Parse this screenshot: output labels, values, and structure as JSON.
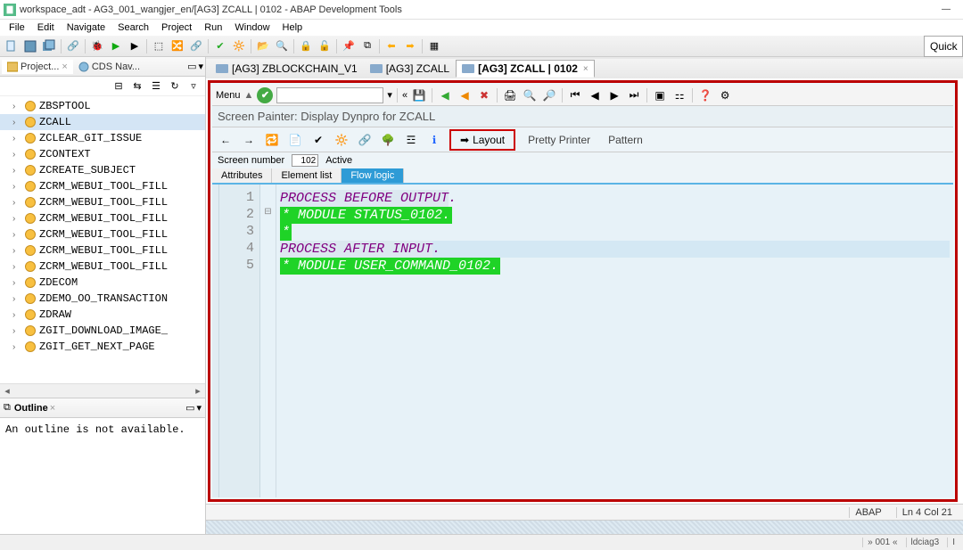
{
  "titlebar": {
    "title": "workspace_adt - AG3_001_wangjer_en/[AG3] ZCALL | 0102 - ABAP Development Tools"
  },
  "menubar": [
    "File",
    "Edit",
    "Navigate",
    "Search",
    "Project",
    "Run",
    "Window",
    "Help"
  ],
  "quick_access": "Quick",
  "left": {
    "tab_project": "Project...",
    "tab_cds": "CDS Nav...",
    "tree": [
      "ZBSPTOOL",
      "ZCALL",
      "ZCLEAR_GIT_ISSUE",
      "ZCONTEXT",
      "ZCREATE_SUBJECT",
      "ZCRM_WEBUI_TOOL_FILL",
      "ZCRM_WEBUI_TOOL_FILL",
      "ZCRM_WEBUI_TOOL_FILL",
      "ZCRM_WEBUI_TOOL_FILL",
      "ZCRM_WEBUI_TOOL_FILL",
      "ZCRM_WEBUI_TOOL_FILL",
      "ZDECOM",
      "ZDEMO_OO_TRANSACTION",
      "ZDRAW",
      "ZGIT_DOWNLOAD_IMAGE_",
      "ZGIT_GET_NEXT_PAGE"
    ],
    "selected_index": 1
  },
  "outline": {
    "title": "Outline",
    "message": "An outline is not available."
  },
  "editor_tabs": [
    {
      "label": "[AG3] ZBLOCKCHAIN_V1",
      "active": false
    },
    {
      "label": "[AG3] ZCALL",
      "active": false
    },
    {
      "label": "[AG3] ZCALL | 0102",
      "active": true
    }
  ],
  "sap": {
    "menu_label": "Menu",
    "painter_title": "Screen Painter: Display Dynpro for ZCALL",
    "layout_btn": "Layout",
    "pretty_printer": "Pretty Printer",
    "pattern": "Pattern",
    "screen_number_label": "Screen number",
    "screen_number_value": "102",
    "status_active": "Active",
    "sub_tabs": [
      "Attributes",
      "Element list",
      "Flow logic"
    ],
    "active_sub_tab": 2
  },
  "code": {
    "lines": [
      {
        "type": "kw",
        "text": "PROCESS BEFORE OUTPUT"
      },
      {
        "type": "comment",
        "text": "* MODULE STATUS_0102."
      },
      {
        "type": "comment",
        "text": "*"
      },
      {
        "type": "kw",
        "text": "PROCESS AFTER INPUT",
        "highlight": true
      },
      {
        "type": "comment",
        "text": "* MODULE USER_COMMAND_0102."
      }
    ]
  },
  "editor_status": {
    "lang": "ABAP",
    "pos": "Ln   4 Col  21"
  },
  "app_status": {
    "a": "» 001 «",
    "b": "ldciag3",
    "c": "I"
  }
}
